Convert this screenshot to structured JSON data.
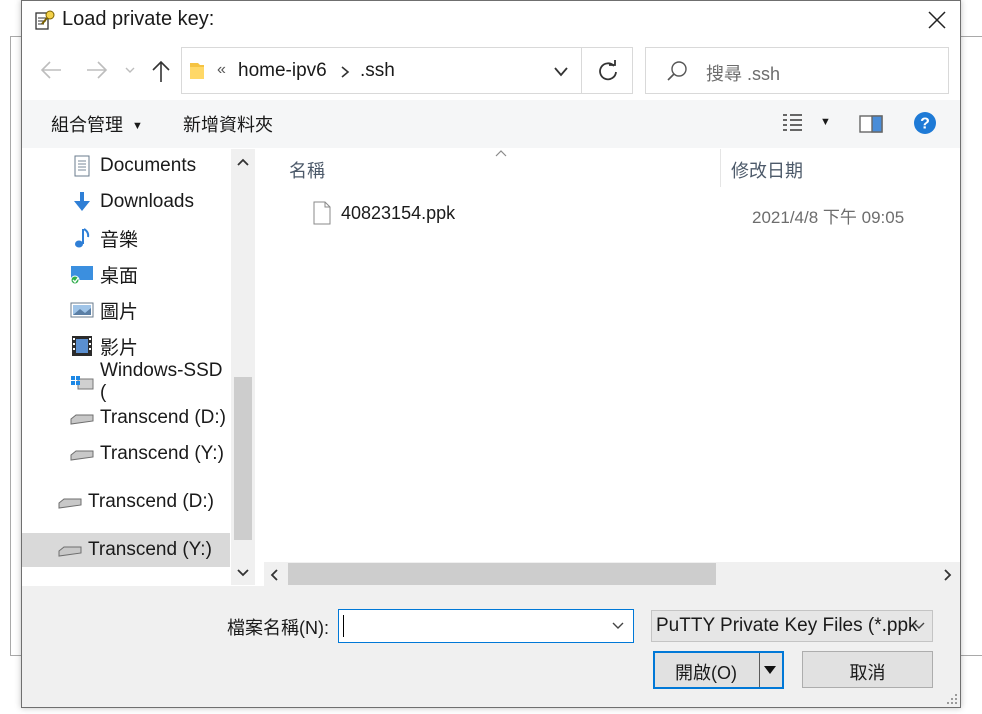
{
  "window": {
    "title": "Load private key:"
  },
  "address": {
    "overflow": "«",
    "crumbs": [
      "home-ipv6",
      ".ssh"
    ]
  },
  "search": {
    "placeholder": "搜尋 .ssh"
  },
  "toolbar": {
    "organize": "組合管理",
    "new_folder": "新增資料夾"
  },
  "nav": {
    "items": [
      {
        "label": "Documents",
        "icon": "documents-icon"
      },
      {
        "label": "Downloads",
        "icon": "downloads-icon"
      },
      {
        "label": "音樂",
        "icon": "music-icon"
      },
      {
        "label": "桌面",
        "icon": "desktop-icon"
      },
      {
        "label": "圖片",
        "icon": "pictures-icon"
      },
      {
        "label": "影片",
        "icon": "videos-icon"
      },
      {
        "label": "Windows-SSD (",
        "icon": "system-drive-icon"
      },
      {
        "label": "Transcend (D:)",
        "icon": "drive-icon"
      },
      {
        "label": "Transcend (Y:)",
        "icon": "drive-icon"
      },
      {
        "label": "Transcend (D:)",
        "icon": "drive-icon"
      },
      {
        "label": "Transcend (Y:)",
        "icon": "drive-icon",
        "selected": true
      }
    ]
  },
  "files": {
    "columns": {
      "name": "名稱",
      "modified": "修改日期"
    },
    "rows": [
      {
        "name": "40823154.ppk",
        "modified": "2021/4/8 下午 09:05"
      }
    ]
  },
  "footer": {
    "filename_label": "檔案名稱(N):",
    "filename_value": "",
    "filetype": "PuTTY Private Key Files (*.ppk",
    "open": "開啟(O)",
    "cancel": "取消"
  },
  "colors": {
    "accent": "#0078d7",
    "help": "#1e7ad6",
    "toolbar": "#f5f6f7"
  }
}
